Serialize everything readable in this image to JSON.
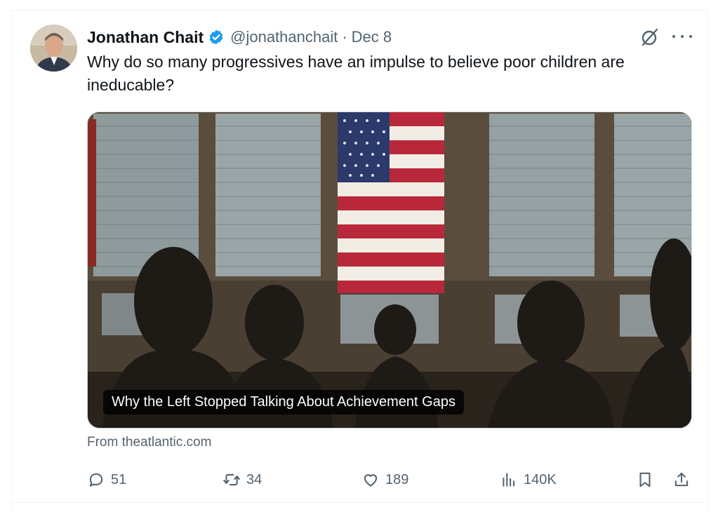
{
  "tweet": {
    "author_name": "Jonathan Chait",
    "handle": "@jonathanchait",
    "separator": "·",
    "date": "Dec 8",
    "text": "Why do so many progressives have an impulse to believe poor children are ineducable?",
    "verified": true,
    "colors": {
      "verified": "#1d9bf0",
      "muted": "#536471",
      "text": "#0f1419"
    }
  },
  "card": {
    "title": "Why the Left Stopped Talking About Achievement Gaps",
    "source": "From theatlantic.com"
  },
  "actions": {
    "replies": "51",
    "reposts": "34",
    "likes": "189",
    "views": "140K"
  },
  "icons": [
    "grok-icon",
    "more-icon",
    "reply-icon",
    "repost-icon",
    "like-icon",
    "views-icon",
    "bookmark-icon",
    "share-icon",
    "verified-badge-icon"
  ]
}
